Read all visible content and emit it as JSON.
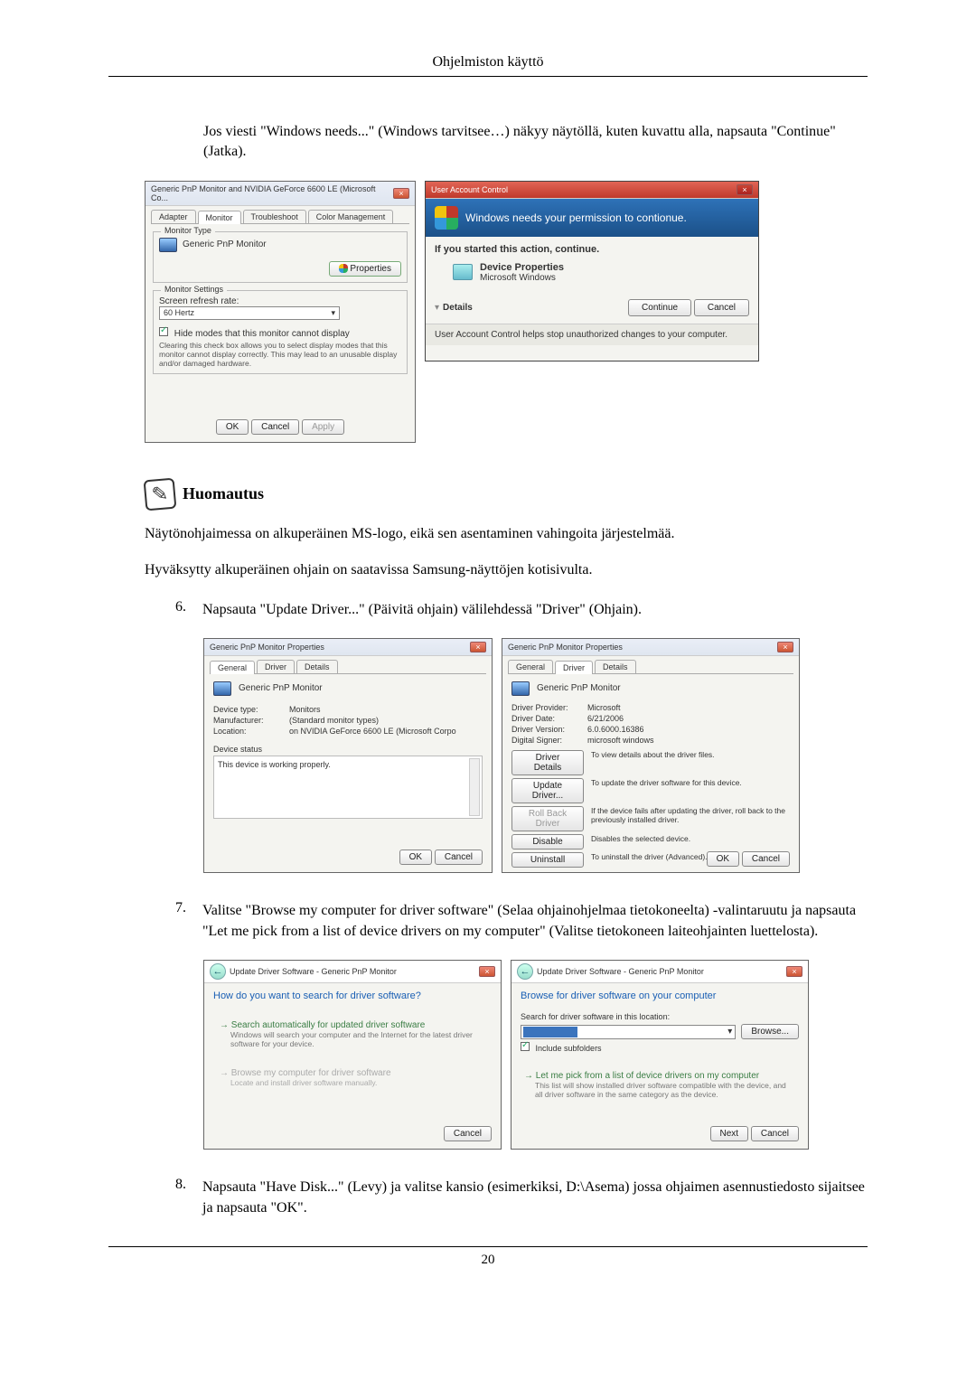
{
  "header": {
    "title": "Ohjelmiston käyttö"
  },
  "intro_para": "Jos viesti \"Windows needs...\" (Windows tarvitsee…) näkyy näytöllä, kuten kuvattu alla, napsauta \"Continue\" (Jatka).",
  "fig1_left": {
    "title": "Generic PnP Monitor and NVIDIA GeForce 6600 LE (Microsoft Co...",
    "tabs": {
      "adapter": "Adapter",
      "monitor": "Monitor",
      "troubleshoot": "Troubleshoot",
      "color": "Color Management"
    },
    "monitor_type_label": "Monitor Type",
    "monitor_type_value": "Generic PnP Monitor",
    "properties_btn": "Properties",
    "monitor_settings_label": "Monitor Settings",
    "refresh_label": "Screen refresh rate:",
    "refresh_value": "60 Hertz",
    "hide_modes": "Hide modes that this monitor cannot display",
    "hide_desc": "Clearing this check box allows you to select display modes that this monitor cannot display correctly. This may lead to an unusable display and/or damaged hardware.",
    "ok": "OK",
    "cancel": "Cancel",
    "apply": "Apply"
  },
  "fig1_right": {
    "title": "User Account Control",
    "banner": "Windows needs your permission to contionue.",
    "started": "If you started this action, continue.",
    "dp": "Device Properties",
    "mw": "Microsoft Windows",
    "details": "Details",
    "continue": "Continue",
    "cancel": "Cancel",
    "footer": "User Account Control helps stop unauthorized changes to your computer."
  },
  "note": {
    "label": "Huomautus"
  },
  "note_p1": "Näytönohjaimessa on alkuperäinen MS-logo, eikä sen asentaminen vahingoita järjestelmää.",
  "note_p2": "Hyväksytty alkuperäinen ohjain on saatavissa Samsung-näyttöjen kotisivulta.",
  "step6": {
    "n": "6.",
    "t": "Napsauta \"Update Driver...\" (Päivitä ohjain) välilehdessä \"Driver\" (Ohjain)."
  },
  "fig2_left": {
    "title": "Generic PnP Monitor Properties",
    "tabs": {
      "general": "General",
      "driver": "Driver",
      "details": "Details"
    },
    "name": "Generic PnP Monitor",
    "devtype_k": "Device type:",
    "devtype_v": "Monitors",
    "manuf_k": "Manufacturer:",
    "manuf_v": "(Standard monitor types)",
    "loc_k": "Location:",
    "loc_v": "on NVIDIA GeForce 6600 LE (Microsoft Corpo",
    "status_label": "Device status",
    "status_text": "This device is working properly.",
    "ok": "OK",
    "cancel": "Cancel"
  },
  "fig2_right": {
    "title": "Generic PnP Monitor Properties",
    "tabs": {
      "general": "General",
      "driver": "Driver",
      "details": "Details"
    },
    "name": "Generic PnP Monitor",
    "provider_k": "Driver Provider:",
    "provider_v": "Microsoft",
    "date_k": "Driver Date:",
    "date_v": "6/21/2006",
    "version_k": "Driver Version:",
    "version_v": "6.0.6000.16386",
    "signer_k": "Digital Signer:",
    "signer_v": "microsoft windows",
    "b_details": "Driver Details",
    "b_details_d": "To view details about the driver files.",
    "b_update": "Update Driver...",
    "b_update_d": "To update the driver software for this device.",
    "b_roll": "Roll Back Driver",
    "b_roll_d": "If the device fails after updating the driver, roll back to the previously installed driver.",
    "b_disable": "Disable",
    "b_disable_d": "Disables the selected device.",
    "b_uninstall": "Uninstall",
    "b_uninstall_d": "To uninstall the driver (Advanced).",
    "ok": "OK",
    "cancel": "Cancel"
  },
  "step7": {
    "n": "7.",
    "t": "Valitse \"Browse my computer for driver software\" (Selaa ohjainohjelmaa tietokoneelta) -valintaruutu ja napsauta \"Let me pick from a list of device drivers on my computer\" (Valitse tietokoneen laiteohjainten luettelosta)."
  },
  "fig3_left": {
    "title": "Update Driver Software - Generic PnP Monitor",
    "heading": "How do you want to search for driver software?",
    "opt1_t": "Search automatically for updated driver software",
    "opt1_d": "Windows will search your computer and the Internet for the latest driver software for your device.",
    "opt2_t": "Browse my computer for driver software",
    "opt2_d": "Locate and install driver software manually.",
    "cancel": "Cancel"
  },
  "fig3_right": {
    "title": "Update Driver Software - Generic PnP Monitor",
    "heading": "Browse for driver software on your computer",
    "loc_label": "Search for driver software in this location:",
    "browse": "Browse...",
    "include": "Include subfolders",
    "pick_t": "Let me pick from a list of device drivers on my computer",
    "pick_d": "This list will show installed driver software compatible with the device, and all driver software in the same category as the device.",
    "next": "Next",
    "cancel": "Cancel"
  },
  "step8": {
    "n": "8.",
    "t": "Napsauta \"Have Disk...\" (Levy) ja valitse kansio (esimerkiksi, D:\\Asema) jossa ohjaimen asennustiedosto sijaitsee ja napsauta \"OK\"."
  },
  "footer": {
    "page": "20"
  }
}
